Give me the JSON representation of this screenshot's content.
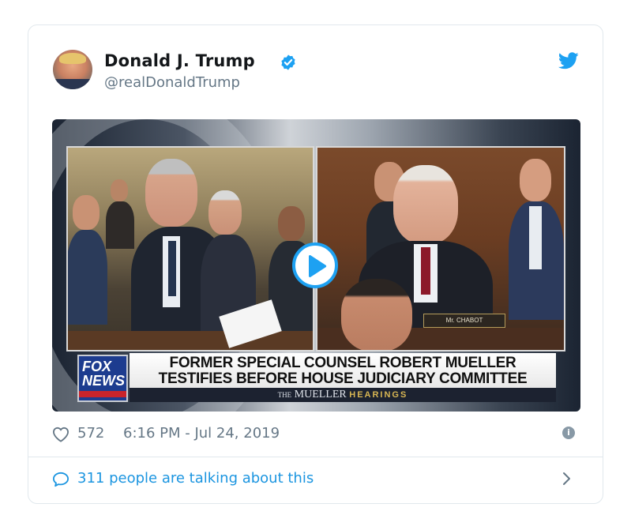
{
  "tweet": {
    "author_name": "Donald J. Trump",
    "handle": "@realDonaldTrump",
    "verified": true,
    "likes": "572",
    "timestamp": "6:16 PM - Jul 24, 2019",
    "talking": "311 people are talking about this"
  },
  "video": {
    "headline_line1": "FORMER SPECIAL COUNSEL ROBERT MUELLER",
    "headline_line2": "TESTIFIES BEFORE HOUSE JUDICIARY COMMITTEE",
    "network_logo": "FOX NEWS",
    "bar_prefix": "THE",
    "bar_title": "MUELLER",
    "bar_suffix": "HEARINGS",
    "nameplate": "Mr. CHABOT"
  },
  "icons": {
    "verified": "verified-badge-icon",
    "twitter": "twitter-bird-icon",
    "play": "play-icon",
    "heart": "heart-icon",
    "info": "info-icon",
    "bubble": "speech-bubble-icon",
    "chevron": "chevron-right-icon"
  },
  "colors": {
    "twitter_blue": "#1da1f2",
    "link_blue": "#1b95e0",
    "muted": "#657786",
    "text": "#14171a",
    "border": "#e1e8ed"
  }
}
